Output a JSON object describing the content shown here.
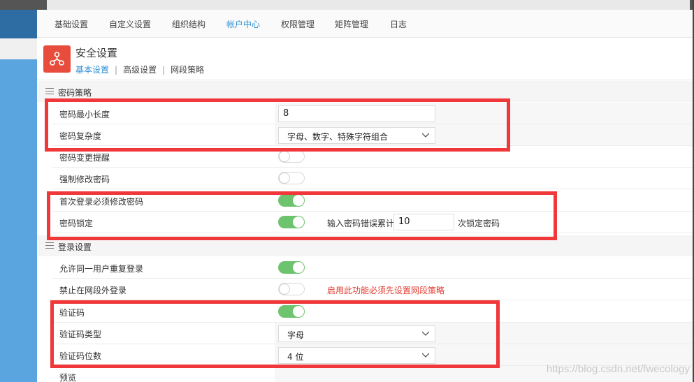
{
  "tabs": [
    "基础设置",
    "自定义设置",
    "组织结构",
    "帐户中心",
    "权限管理",
    "矩阵管理",
    "日志"
  ],
  "active_tab": "帐户中心",
  "header": {
    "title": "安全设置",
    "subnav": [
      "基本设置",
      "高级设置",
      "网段策略"
    ]
  },
  "password_section": {
    "title": "密码策略",
    "rows": {
      "min_length": {
        "label": "密码最小长度",
        "value": "8"
      },
      "complexity": {
        "label": "密码复杂度",
        "value": "字母、数字、特殊字符组合"
      },
      "change_reminder": {
        "label": "密码变更提醒",
        "on": false
      },
      "force_change": {
        "label": "强制修改密码",
        "on": false
      },
      "first_login_change": {
        "label": "首次登录必须修改密码",
        "on": true
      },
      "lock": {
        "label": "密码锁定",
        "on": true,
        "prefix": "输入密码错误累计",
        "value": "10",
        "suffix": "次锁定密码"
      }
    }
  },
  "login_section": {
    "title": "登录设置",
    "rows": {
      "allow_duplicate": {
        "label": "允许同一用户重复登录",
        "on": true
      },
      "forbid_outside": {
        "label": "禁止在网段外登录",
        "on": false,
        "note": "启用此功能必须先设置网段策略"
      },
      "captcha": {
        "label": "验证码",
        "on": true
      },
      "captcha_type": {
        "label": "验证码类型",
        "value": "字母"
      },
      "captcha_digits": {
        "label": "验证码位数",
        "value": "4 位"
      },
      "preview": {
        "label": "预览"
      }
    }
  },
  "watermark": "https://blog.csdn.net/fwecology",
  "colors": {
    "accent": "#2f8fd4",
    "toggle_on": "#6ec46e",
    "highlight": "#f0373a",
    "icon_bg": "#e74c3c"
  }
}
